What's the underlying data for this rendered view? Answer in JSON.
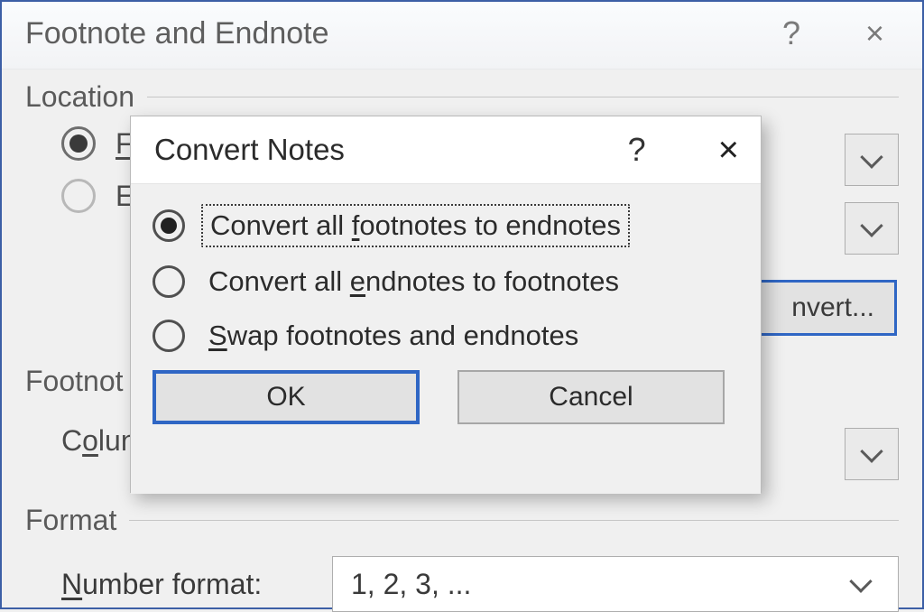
{
  "parent": {
    "title": "Footnote and Endnote",
    "sections": {
      "location": "Location",
      "footnote_layout": "Footnot",
      "format": "Format"
    },
    "radio_fo": "F",
    "radio_en": "E",
    "columns_label_prefix": "C",
    "columns_label_accel": "o",
    "columns_label_rest": "lun",
    "convert_button": "nvert...",
    "number_format_label_accel": "N",
    "number_format_label_rest": "umber format:",
    "number_format_value": "1, 2, 3, ..."
  },
  "modal": {
    "title": "Convert Notes",
    "options": {
      "opt1_pre": "Convert all ",
      "opt1_accel": "f",
      "opt1_rest": "ootnotes to endnotes",
      "opt2_pre": "Convert all ",
      "opt2_accel": "e",
      "opt2_rest": "ndnotes to footnotes",
      "opt3_accel": "S",
      "opt3_rest": "wap footnotes and endnotes"
    },
    "buttons": {
      "ok": "OK",
      "cancel": "Cancel"
    }
  }
}
